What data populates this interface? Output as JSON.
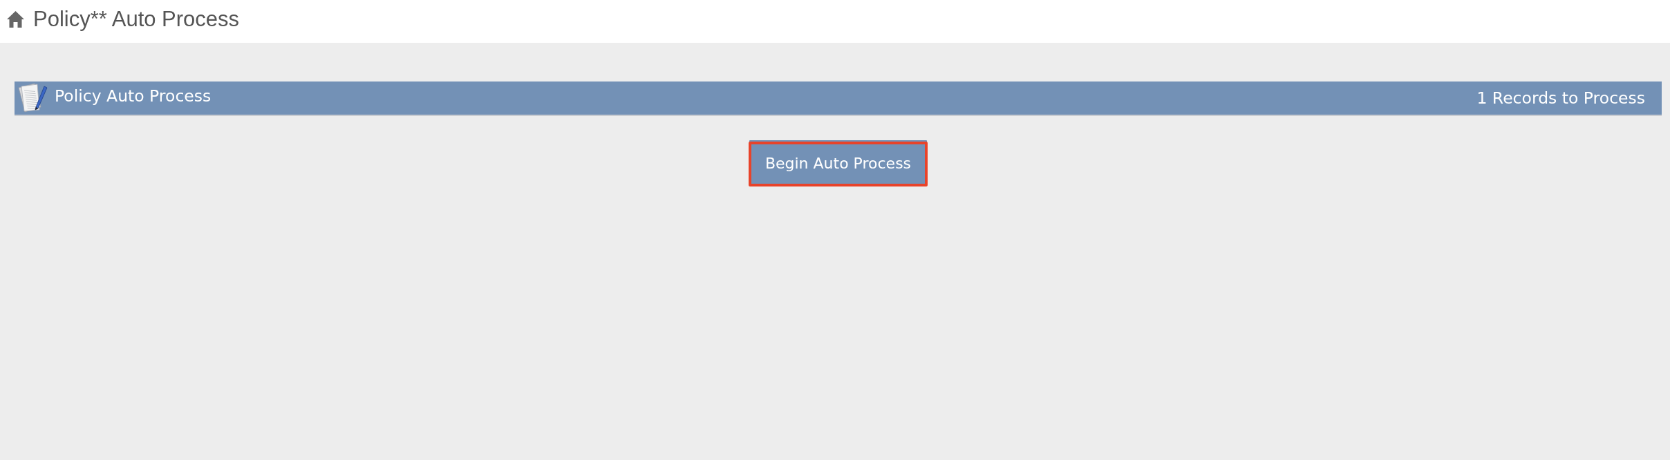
{
  "header": {
    "title": "Policy** Auto Process"
  },
  "panel": {
    "title": "Policy Auto Process",
    "record_count": "1 Records to Process"
  },
  "actions": [
    {
      "label": "Begin Auto Process",
      "highlighted": true
    }
  ]
}
